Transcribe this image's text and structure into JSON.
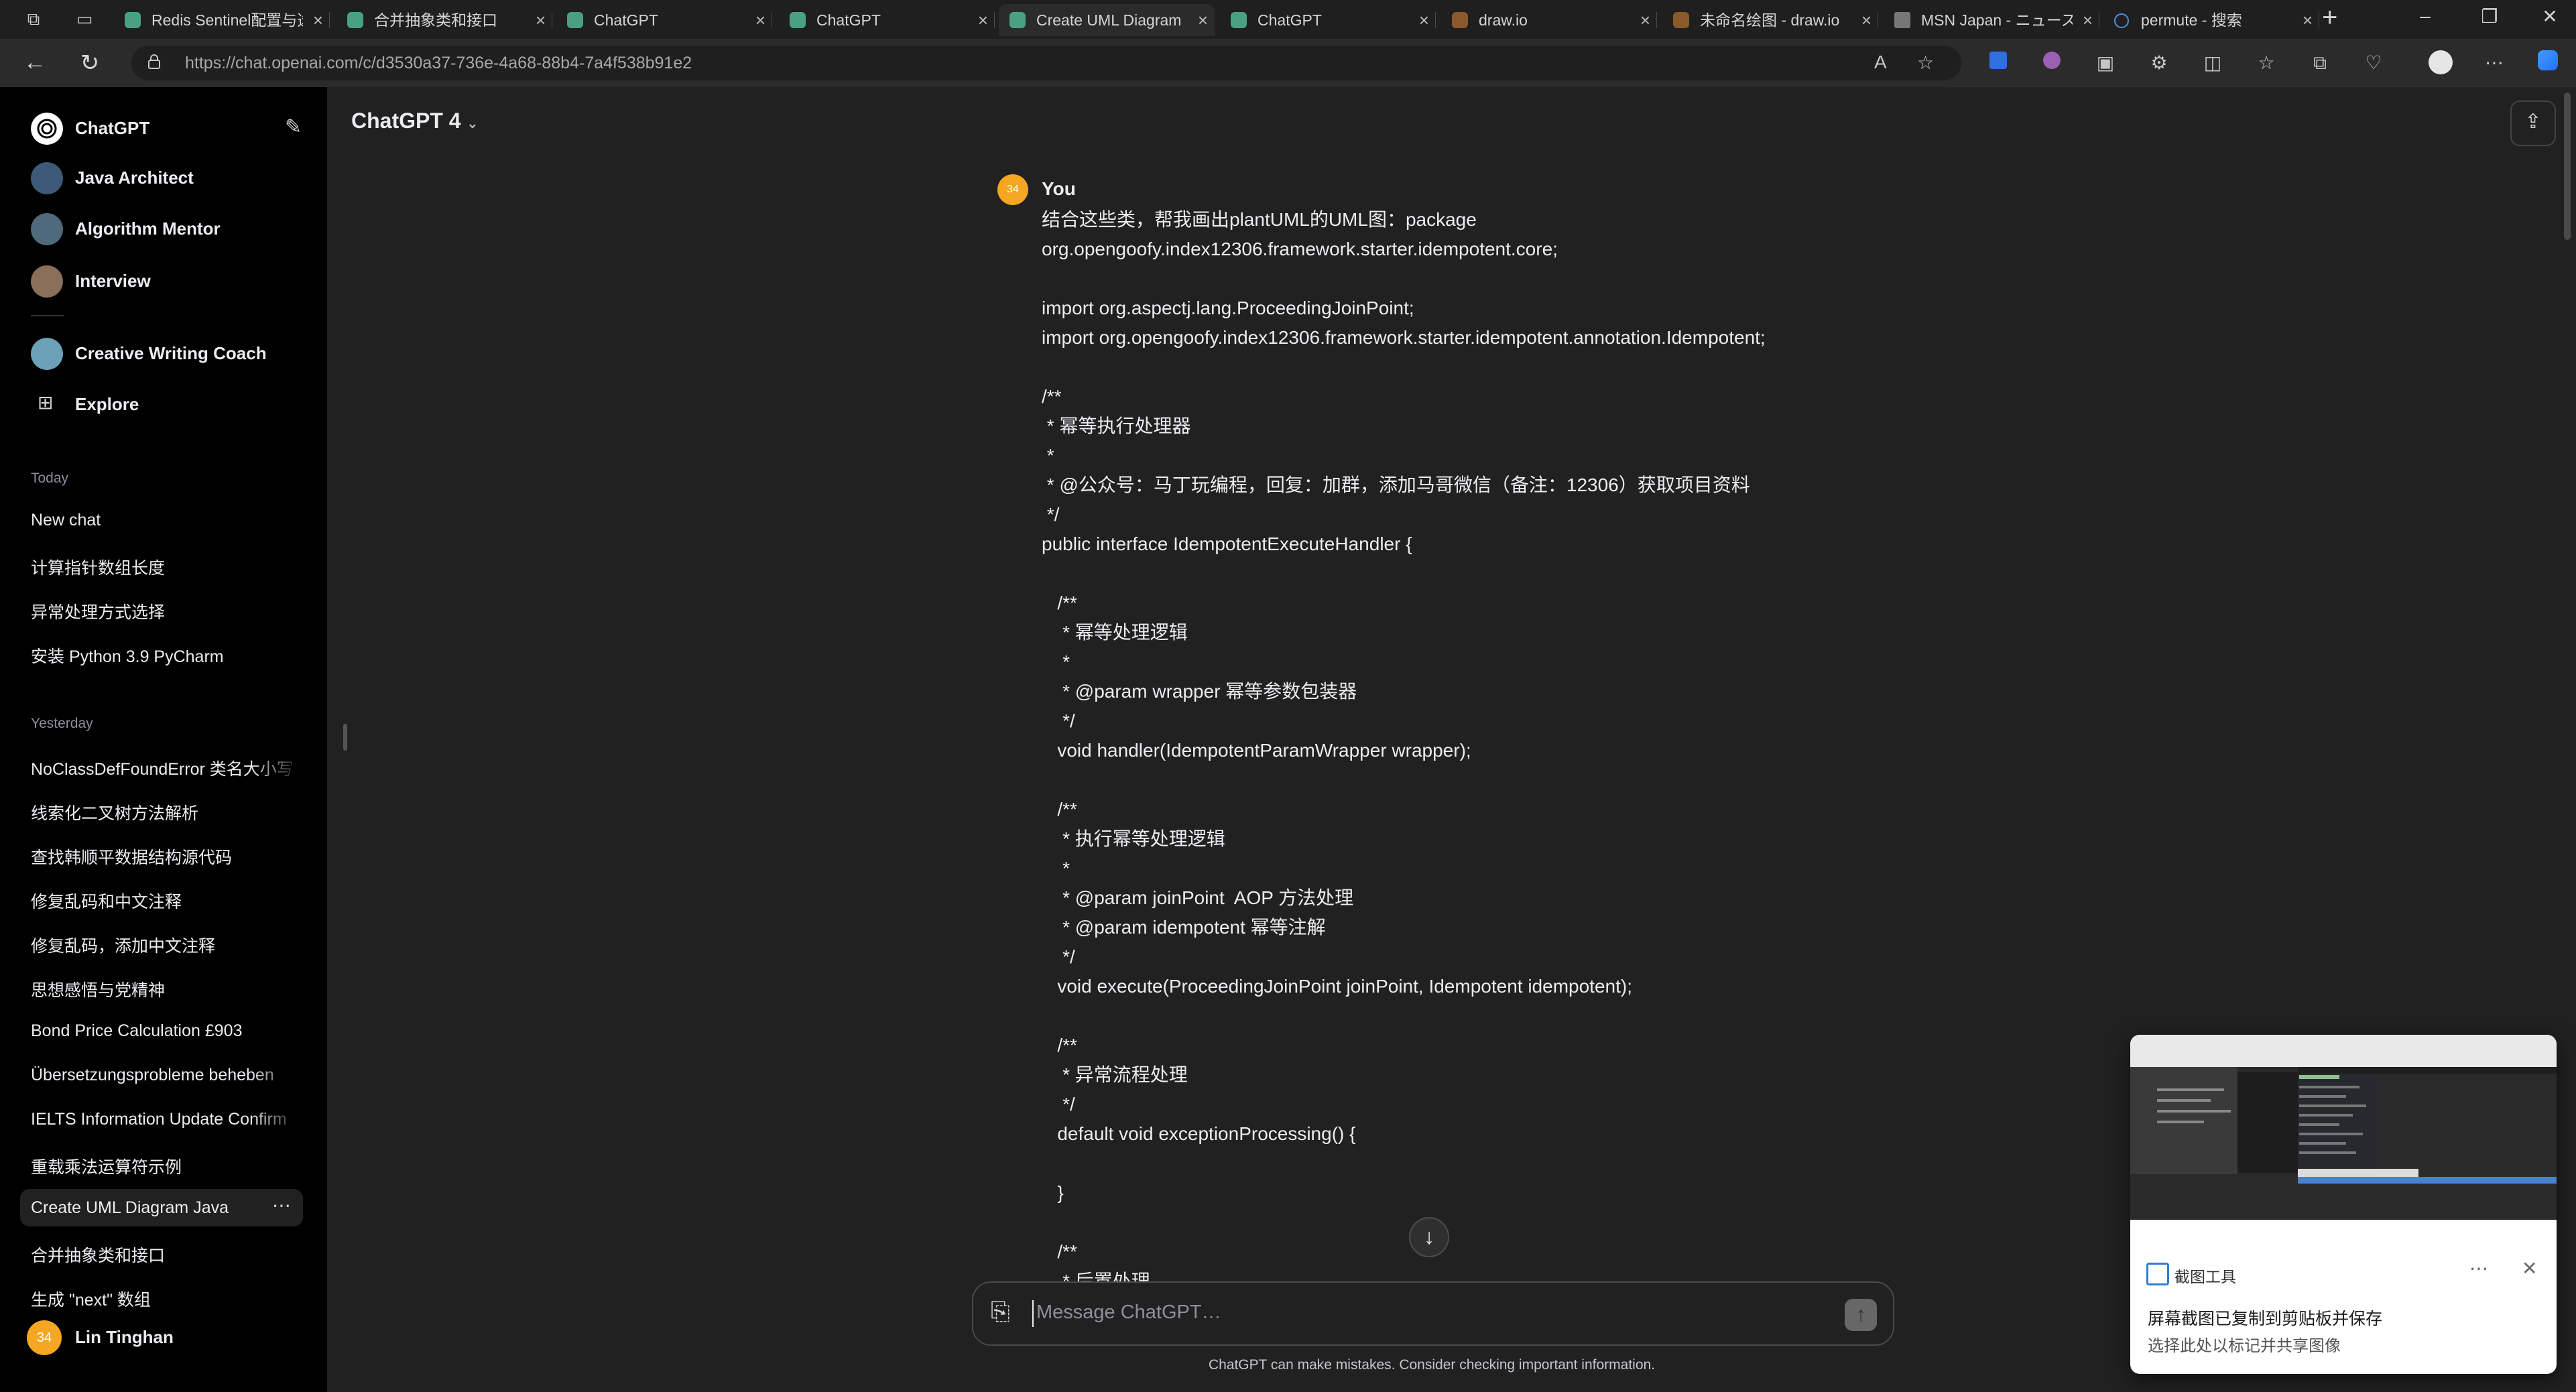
{
  "browser": {
    "tabs": [
      {
        "title": "Redis Sentinel配置与选",
        "favicon": "chatgpt-icon"
      },
      {
        "title": "合并抽象类和接口",
        "favicon": "chatgpt-icon"
      },
      {
        "title": "ChatGPT",
        "favicon": "chatgpt-icon"
      },
      {
        "title": "ChatGPT",
        "favicon": "chatgpt-icon"
      },
      {
        "title": "Create UML Diagram",
        "favicon": "chatgpt-icon",
        "active": true
      },
      {
        "title": "ChatGPT",
        "favicon": "chatgpt-icon"
      },
      {
        "title": "draw.io",
        "favicon": "drawio-icon"
      },
      {
        "title": "未命名绘图 - draw.io",
        "favicon": "drawio-icon"
      },
      {
        "title": "MSN Japan - ニュース",
        "favicon": "msn-icon"
      },
      {
        "title": "permute - 搜索",
        "favicon": "search-icon"
      }
    ],
    "url": "https://chat.openai.com/c/d3530a37-736e-4a68-88b4-7a4f538b91e2"
  },
  "sidebar": {
    "brand": "ChatGPT",
    "gpts": [
      {
        "label": "Java Architect",
        "color": "#3c5a78"
      },
      {
        "label": "Algorithm Mentor",
        "color": "#4f6a7a"
      },
      {
        "label": "Interview",
        "color": "#8a6f5a"
      },
      {
        "label": "Creative Writing Coach",
        "color": "#6aa0b8"
      }
    ],
    "explore": "Explore",
    "sections": [
      {
        "title": "Today",
        "items": [
          "New chat",
          "计算指针数组长度",
          "异常处理方式选择",
          "安装 Python 3.9 PyCharm"
        ]
      },
      {
        "title": "Yesterday",
        "items": [
          "NoClassDefFoundError 类名大小写",
          "线索化二叉树方法解析",
          "查找韩顺平数据结构源代码",
          "修复乱码和中文注释",
          "修复乱码，添加中文注释",
          "思想感悟与党精神",
          "Bond Price Calculation £903",
          "Übersetzungsprobleme beheben",
          "IELTS Information Update Confirm",
          "重载乘法运算符示例",
          "Create UML Diagram Java",
          "合并抽象类和接口",
          "生成 \"next\" 数组"
        ]
      }
    ],
    "active_chat": "Create UML Diagram Java",
    "user": {
      "name": "Lin Tinghan",
      "initials": "34"
    }
  },
  "main": {
    "model": "ChatGPT 4",
    "message": {
      "author": "You",
      "avatar": "34",
      "lines": [
        "结合这些类，帮我画出plantUML的UML图：package",
        "org.opengoofy.index12306.framework.starter.idempotent.core;",
        "",
        "import org.aspectj.lang.ProceedingJoinPoint;",
        "import org.opengoofy.index12306.framework.starter.idempotent.annotation.Idempotent;",
        "",
        "/**",
        " * 幂等执行处理器",
        " *",
        " * @公众号：马丁玩编程，回复：加群，添加马哥微信（备注：12306）获取项目资料",
        " */",
        "public interface IdempotentExecuteHandler {",
        "",
        "   /**",
        "    * 幂等处理逻辑",
        "    *",
        "    * @param wrapper 幂等参数包装器",
        "    */",
        "   void handler(IdempotentParamWrapper wrapper);",
        "",
        "   /**",
        "    * 执行幂等处理逻辑",
        "    *",
        "    * @param joinPoint  AOP 方法处理",
        "    * @param idempotent 幂等注解",
        "    */",
        "   void execute(ProceedingJoinPoint joinPoint, Idempotent idempotent);",
        "",
        "   /**",
        "    * 异常流程处理",
        "    */",
        "   default void exceptionProcessing() {",
        "",
        "   }",
        "",
        "   /**",
        "    * 后置处理"
      ]
    },
    "composer_placeholder": "Message ChatGPT…",
    "disclaimer": "ChatGPT can make mistakes. Consider checking important information."
  },
  "toast": {
    "app": "截图工具",
    "line1": "屏幕截图已复制到剪贴板并保存",
    "line2": "选择此处以标记并共享图像"
  },
  "colors": {
    "accent": "#f5a623",
    "sidebar_bg": "#000000",
    "main_bg": "#212121"
  }
}
